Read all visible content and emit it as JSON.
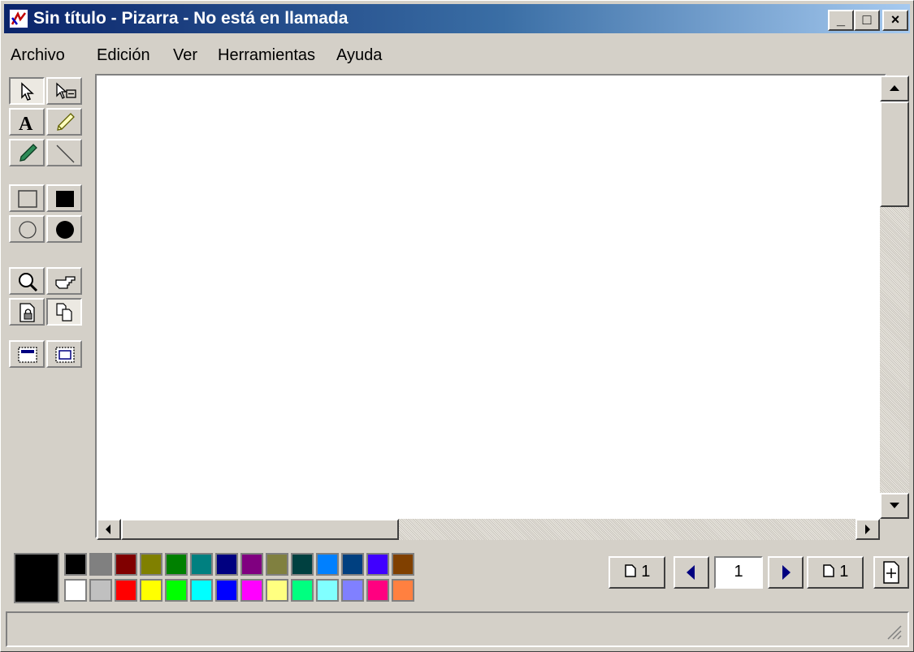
{
  "window": {
    "title": "Sin título - Pizarra - No está en llamada",
    "minimize_label": "_",
    "maximize_label": "□",
    "close_label": "×"
  },
  "menu": {
    "items": [
      "Archivo",
      "Edición",
      "Ver",
      "Herramientas",
      "Ayuda"
    ]
  },
  "toolbox": {
    "tools": [
      {
        "name": "select-icon",
        "pressed": true
      },
      {
        "name": "area-select-icon",
        "pressed": false
      },
      {
        "name": "text-icon",
        "pressed": false
      },
      {
        "name": "highlighter-icon",
        "pressed": false
      },
      {
        "name": "pen-icon",
        "pressed": false
      },
      {
        "name": "line-icon",
        "pressed": false
      },
      {
        "name": "unfilled-rectangle-icon",
        "pressed": false
      },
      {
        "name": "filled-rectangle-icon",
        "pressed": false
      },
      {
        "name": "unfilled-ellipse-icon",
        "pressed": false
      },
      {
        "name": "filled-ellipse-icon",
        "pressed": false
      },
      {
        "name": "zoom-icon",
        "pressed": false
      },
      {
        "name": "remote-pointer-icon",
        "pressed": false
      },
      {
        "name": "lock-contents-icon",
        "pressed": false
      },
      {
        "name": "synchronize-icon",
        "pressed": true
      },
      {
        "name": "select-window-icon",
        "pressed": false
      },
      {
        "name": "select-area-icon",
        "pressed": false
      }
    ]
  },
  "palette": {
    "current_color": "#000000",
    "top_row": [
      "#000000",
      "#808080",
      "#800000",
      "#808000",
      "#008000",
      "#008080",
      "#000080",
      "#800080",
      "#808040",
      "#004040",
      "#0080ff",
      "#004080",
      "#4000ff",
      "#804000"
    ],
    "bottom_row": [
      "#ffffff",
      "#c0c0c0",
      "#ff0000",
      "#ffff00",
      "#00ff00",
      "#00ffff",
      "#0000ff",
      "#ff00ff",
      "#ffff80",
      "#00ff80",
      "#80ffff",
      "#8080ff",
      "#ff0080",
      "#ff8040"
    ]
  },
  "navigation": {
    "first_page_label": "1",
    "current_page": "1",
    "last_page_label": "1"
  }
}
